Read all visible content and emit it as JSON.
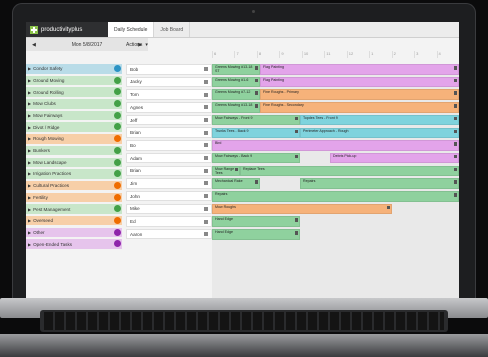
{
  "app": {
    "logo_text": "productivityplus",
    "tabs": [
      "Daily Schedule",
      "Job Board"
    ],
    "date": "Mon 5/8/2017",
    "actions_label": "Actions"
  },
  "categories": [
    {
      "label": "Condor Safety",
      "color": "#b9dce8",
      "dot": "#2b93c4"
    },
    {
      "label": "Ground Moving",
      "color": "#c8e6c9",
      "dot": "#43a047"
    },
    {
      "label": "Ground Rolling",
      "color": "#c8e6c9",
      "dot": "#43a047"
    },
    {
      "label": "Mow Clubs",
      "color": "#c8e6c9",
      "dot": "#43a047"
    },
    {
      "label": "Mow Fairways",
      "color": "#c8e6c9",
      "dot": "#43a047"
    },
    {
      "label": "Divot / Ridge",
      "color": "#c8e6c9",
      "dot": "#43a047"
    },
    {
      "label": "Rough Mowing",
      "color": "#f7cfa8",
      "dot": "#ef6c00"
    },
    {
      "label": "Bunkers",
      "color": "#c8e6c9",
      "dot": "#43a047"
    },
    {
      "label": "Mow Landscape",
      "color": "#c8e6c9",
      "dot": "#43a047"
    },
    {
      "label": "Irrigation Practices",
      "color": "#c8e6c9",
      "dot": "#43a047"
    },
    {
      "label": "Cultural Practices",
      "color": "#f7cfa8",
      "dot": "#ef6c00"
    },
    {
      "label": "Fertility",
      "color": "#f7cfa8",
      "dot": "#ef6c00"
    },
    {
      "label": "Pest Management",
      "color": "#c8e6c9",
      "dot": "#43a047"
    },
    {
      "label": "Overseed",
      "color": "#f7cfa8",
      "dot": "#ef6c00"
    },
    {
      "label": "Other",
      "color": "#e6c4ec",
      "dot": "#8e24aa"
    },
    {
      "label": "Open-Ended Tasks",
      "color": "#e6c4ec",
      "dot": "#8e24aa"
    }
  ],
  "timeline_hours": [
    "6",
    "7",
    "8",
    "9",
    "10",
    "11",
    "12",
    "1",
    "2",
    "3",
    "4"
  ],
  "people": [
    {
      "name": "Bob",
      "tasks": [
        {
          "l": 0,
          "w": 48,
          "t": "Greens Mowing #13-18 ST",
          "c": "#8fd19e"
        },
        {
          "l": 48,
          "w": 199,
          "t": "Flag Painting",
          "c": "#e3a4ea"
        }
      ]
    },
    {
      "name": "Jacky",
      "tasks": [
        {
          "l": 0,
          "w": 48,
          "t": "Greens Mowing #1-6",
          "c": "#8fd19e"
        },
        {
          "l": 48,
          "w": 199,
          "t": "Flag Painting",
          "c": "#e3a4ea"
        }
      ]
    },
    {
      "name": "Tom",
      "tasks": [
        {
          "l": 0,
          "w": 48,
          "t": "Greens Mowing #7-12",
          "c": "#8fd19e"
        },
        {
          "l": 48,
          "w": 199,
          "t": "Fine Roughs - Primary",
          "c": "#f6b27a"
        }
      ]
    },
    {
      "name": "Agnes",
      "tasks": [
        {
          "l": 0,
          "w": 48,
          "t": "Greens Mowing #13-18",
          "c": "#8fd19e"
        },
        {
          "l": 48,
          "w": 199,
          "t": "Fine Roughs - Secondary",
          "c": "#f6b27a"
        }
      ]
    },
    {
      "name": "Jeff",
      "tasks": [
        {
          "l": 0,
          "w": 88,
          "t": "Mow Fairways - Front 9",
          "c": "#8fd19e"
        },
        {
          "l": 88,
          "w": 159,
          "t": "Topdes Tees - Front 9",
          "c": "#7fd3dd"
        }
      ]
    },
    {
      "name": "Brian",
      "tasks": [
        {
          "l": 0,
          "w": 88,
          "t": "Trunks Tees - Back 9",
          "c": "#7fd3dd"
        },
        {
          "l": 88,
          "w": 159,
          "t": "Perimeter Approach - Rough",
          "c": "#7fd3dd"
        }
      ]
    },
    {
      "name": "Bo",
      "tasks": [
        {
          "l": 0,
          "w": 247,
          "t": "Bird",
          "c": "#e3a4ea"
        }
      ]
    },
    {
      "name": "Adam",
      "tasks": [
        {
          "l": 0,
          "w": 88,
          "t": "Mow Fairways - Back 9",
          "c": "#8fd19e"
        },
        {
          "l": 118,
          "w": 129,
          "t": "Debris Pick-up",
          "c": "#e3a4ea"
        }
      ]
    },
    {
      "name": "Brian",
      "tasks": [
        {
          "l": 0,
          "w": 28,
          "t": "Mow Range Tees",
          "c": "#8fd19e"
        },
        {
          "l": 28,
          "w": 219,
          "t": "Replace Tees",
          "c": "#8fd19e"
        }
      ]
    },
    {
      "name": "Jim",
      "tasks": [
        {
          "l": 0,
          "w": 48,
          "t": "Mechanical Rake",
          "c": "#8fd19e"
        },
        {
          "l": 88,
          "w": 159,
          "t": "Repairs",
          "c": "#8fd19e"
        }
      ]
    },
    {
      "name": "John",
      "tasks": [
        {
          "l": 0,
          "w": 247,
          "t": "Repairs",
          "c": "#8fd19e"
        }
      ]
    },
    {
      "name": "Mike",
      "tasks": [
        {
          "l": 0,
          "w": 180,
          "t": "Mow Roughs",
          "c": "#f6b27a"
        }
      ]
    },
    {
      "name": "Ed",
      "tasks": [
        {
          "l": 0,
          "w": 88,
          "t": "Hand Edge",
          "c": "#8fd19e"
        }
      ]
    },
    {
      "name": "Aaron",
      "tasks": [
        {
          "l": 0,
          "w": 88,
          "t": "Hand Edge",
          "c": "#8fd19e"
        }
      ]
    }
  ]
}
